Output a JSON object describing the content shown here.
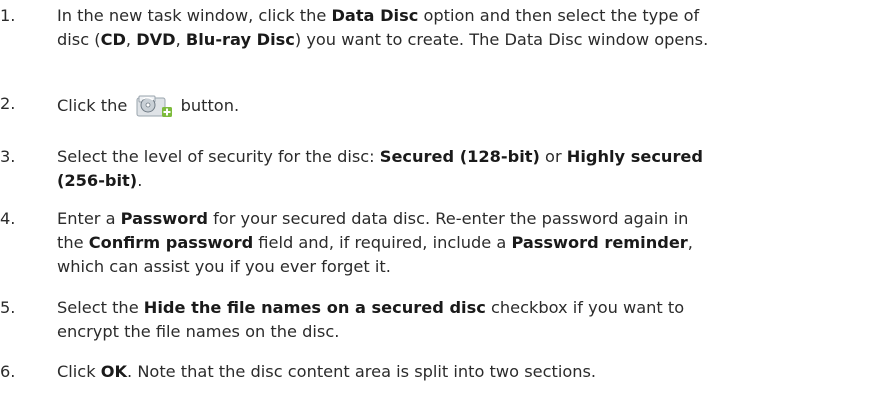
{
  "steps": [
    {
      "number": "1.",
      "lines": [
        [
          "In the new task window, click the ",
          {
            "b": "Data Disc"
          },
          " option and then select the type of"
        ],
        [
          "disc (",
          {
            "b": "CD"
          },
          ", ",
          {
            "b": "DVD"
          },
          ", ",
          {
            "b": "Blu-ray Disc"
          },
          ") you want to create. The Data Disc window opens."
        ]
      ]
    },
    {
      "number": "2.",
      "lines": [
        [
          "Click the ",
          {
            "icon": "add-secure-disc-icon"
          },
          " button."
        ]
      ]
    },
    {
      "number": "3.",
      "lines": [
        [
          "Select the level of security for the disc: ",
          {
            "b": "Secured (128-bit)"
          },
          " or ",
          {
            "b": "Highly secured"
          }
        ],
        [
          {
            "b": "(256-bit)"
          },
          "."
        ]
      ]
    },
    {
      "number": "4.",
      "lines": [
        [
          "Enter a ",
          {
            "b": "Password"
          },
          " for your secured data disc. Re-enter the password again in"
        ],
        [
          "the ",
          {
            "b": "Confirm password"
          },
          " field and, if required, include a ",
          {
            "b": "Password reminder"
          },
          ","
        ],
        [
          "which can assist you if you ever forget it."
        ]
      ]
    },
    {
      "number": "5.",
      "lines": [
        [
          "Select the ",
          {
            "b": "Hide the file names on a secured disc"
          },
          " checkbox if you want to"
        ],
        [
          "encrypt the file names on the disc."
        ]
      ]
    },
    {
      "number": "6.",
      "lines": [
        [
          "Click ",
          {
            "b": "OK"
          },
          ". Note that the disc content area is split into two sections."
        ]
      ]
    }
  ],
  "colors": {
    "text": "#2b2b2b",
    "icon_disc": "#9aa4ad",
    "icon_plus": "#7dbb3c"
  }
}
